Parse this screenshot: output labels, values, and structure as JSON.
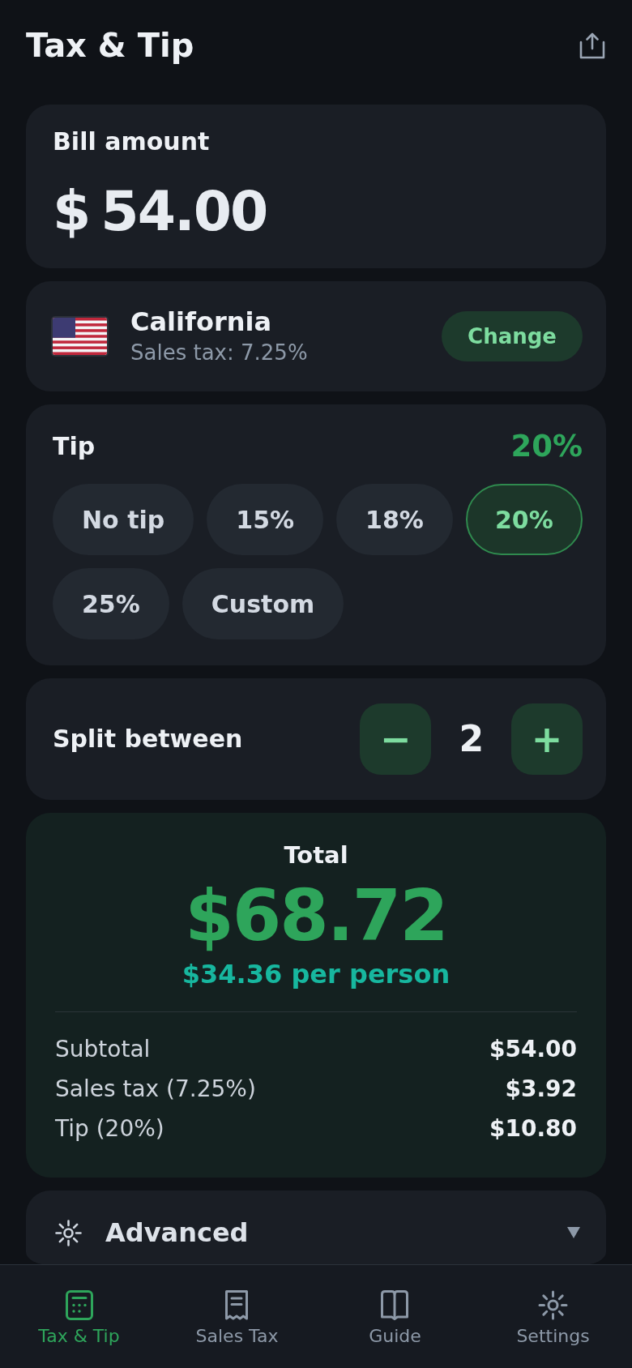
{
  "header": {
    "title": "Tax & Tip"
  },
  "bill": {
    "label": "Bill amount",
    "currency": "$",
    "value": "54.00"
  },
  "location": {
    "name": "California",
    "detail": "Sales tax: 7.25%",
    "button": "Change"
  },
  "tip": {
    "label": "Tip",
    "value": "20%",
    "options": [
      {
        "label": "No tip",
        "selected": false
      },
      {
        "label": "15%",
        "selected": false
      },
      {
        "label": "18%",
        "selected": false
      },
      {
        "label": "20%",
        "selected": true
      },
      {
        "label": "25%",
        "selected": false
      },
      {
        "label": "Custom",
        "selected": false
      }
    ]
  },
  "split": {
    "label": "Split between",
    "decrease": "−",
    "count": "2",
    "increase": "+"
  },
  "total": {
    "label": "Total",
    "amount": "$68.72",
    "per_person": "$34.36 per person",
    "lines": [
      {
        "label": "Subtotal",
        "value": "$54.00"
      },
      {
        "label": "Sales tax (7.25%)",
        "value": "$3.92"
      },
      {
        "label": "Tip (20%)",
        "value": "$10.80"
      }
    ]
  },
  "advanced": {
    "label": "Advanced",
    "expanded": false
  },
  "tabs": [
    {
      "label": "Tax & Tip",
      "selected": true
    },
    {
      "label": "Sales Tax",
      "selected": false
    },
    {
      "label": "Guide",
      "selected": false
    },
    {
      "label": "Settings",
      "selected": false
    }
  ]
}
